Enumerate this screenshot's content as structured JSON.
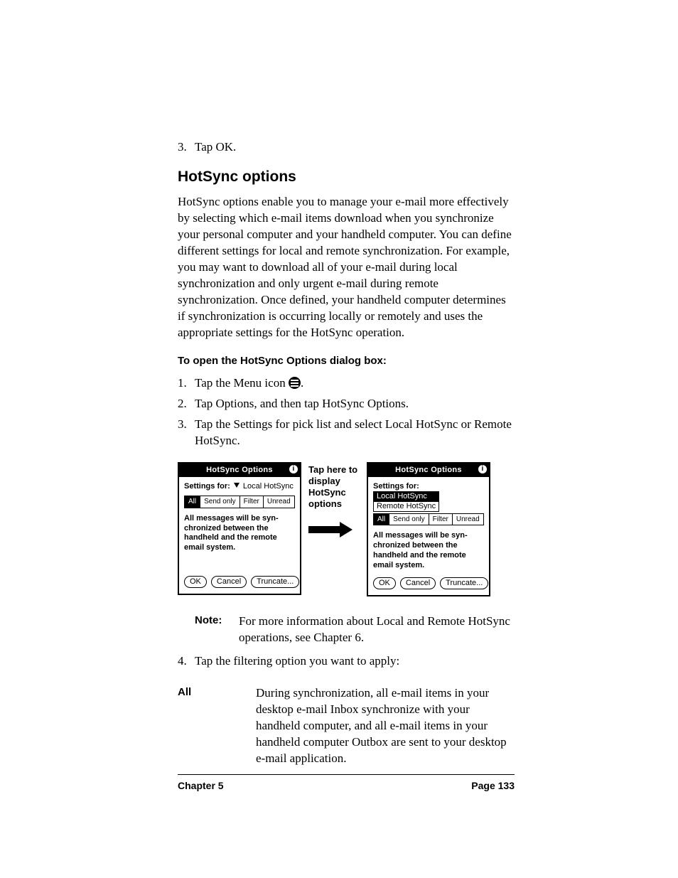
{
  "steps_top": {
    "num": "3.",
    "text": "Tap OK."
  },
  "heading": "HotSync options",
  "intro": "HotSync options enable you to manage your e-mail more effectively by selecting which e-mail items download when you synchronize your personal computer and your handheld computer. You can define different settings for local and remote synchronization. For example, you may want to download all of your e-mail during local synchronization and only urgent e-mail during remote synchronization. Once defined, your handheld computer determines if synchronization is occurring locally or remotely and uses the appropriate settings for the HotSync operation.",
  "subhead": "To open the HotSync Options dialog box:",
  "open_steps": [
    {
      "num": "1.",
      "pre": "Tap the Menu icon ",
      "post": "."
    },
    {
      "num": "2.",
      "text": "Tap Options, and then tap HotSync Options."
    },
    {
      "num": "3.",
      "text": "Tap the Settings for pick list and select Local HotSync or Remote HotSync."
    }
  ],
  "middle_caption": "Tap here to display HotSync options",
  "palm": {
    "title": "HotSync Options",
    "settings_label": "Settings for:",
    "selected": "Local HotSync",
    "dropdown": [
      "Local HotSync",
      "Remote HotSync"
    ],
    "tabs": [
      "All",
      "Send only",
      "Filter",
      "Unread"
    ],
    "message": "All messages will be syn-\nchronized between the\nhandheld and the remote\nemail system.",
    "buttons": [
      "OK",
      "Cancel",
      "Truncate..."
    ]
  },
  "note": {
    "label": "Note:",
    "text": "For more information about Local and Remote HotSync operations, see Chapter 6."
  },
  "step4": {
    "num": "4.",
    "text": "Tap the filtering option you want to apply:"
  },
  "def": {
    "term": "All",
    "text": "During synchronization, all e-mail items in your desktop e-mail Inbox synchronize with your handheld computer, and all e-mail items in your handheld computer Outbox are sent to your desktop e-mail application."
  },
  "footer": {
    "left": "Chapter 5",
    "right": "Page 133"
  }
}
